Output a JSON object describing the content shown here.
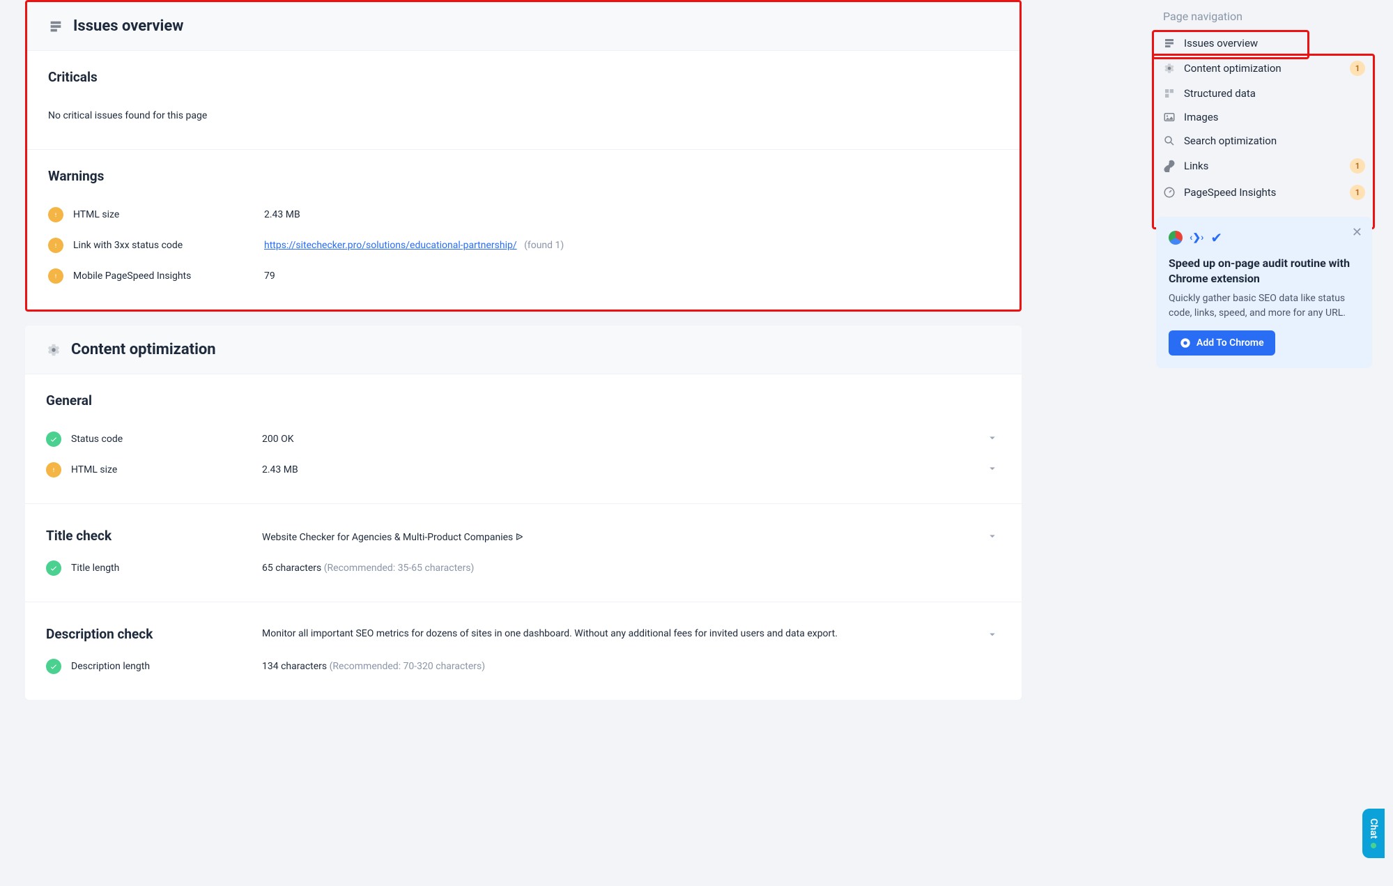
{
  "issues": {
    "title": "Issues overview",
    "criticals_label": "Criticals",
    "criticals_value": "No critical issues found for this page",
    "warnings_label": "Warnings",
    "warnings": [
      {
        "label": "HTML size",
        "value": "2.43 MB",
        "link": "",
        "found": ""
      },
      {
        "label": "Link with 3xx status code",
        "value": "",
        "link": "https://sitechecker.pro/solutions/educational-partnership/",
        "found": "(found 1)"
      },
      {
        "label": "Mobile PageSpeed Insights",
        "value": "79",
        "link": "",
        "found": ""
      }
    ]
  },
  "content": {
    "title": "Content optimization",
    "general_label": "General",
    "status_code_label": "Status code",
    "status_code_value": "200 OK",
    "html_size_label": "HTML size",
    "html_size_value": "2.43 MB",
    "title_check_label": "Title check",
    "title_check_value": "Website Checker for Agencies & Multi-Product Companies ᐉ",
    "title_len_label": "Title length",
    "title_len_value": "65 characters",
    "title_len_hint": "(Recommended: 35-65 characters)",
    "desc_check_label": "Description check",
    "desc_check_value": "Monitor all important SEO metrics for dozens of sites in one dashboard. Without any additional fees for invited users and data export.",
    "desc_len_label": "Description length",
    "desc_len_value": "134 characters",
    "desc_len_hint": "(Recommended: 70-320 characters)"
  },
  "nav": {
    "title": "Page navigation",
    "items": [
      {
        "label": "Issues overview",
        "count": ""
      },
      {
        "label": "Content optimization",
        "count": "1"
      },
      {
        "label": "Structured data",
        "count": ""
      },
      {
        "label": "Images",
        "count": ""
      },
      {
        "label": "Search optimization",
        "count": ""
      },
      {
        "label": "Links",
        "count": "1"
      },
      {
        "label": "PageSpeed Insights",
        "count": "1"
      }
    ]
  },
  "promo": {
    "heading": "Speed up on-page audit routine with Chrome extension",
    "body": "Quickly gather basic SEO data like status code, links, speed, and more for any URL.",
    "cta": "Add To Chrome"
  },
  "chat": "Chat"
}
